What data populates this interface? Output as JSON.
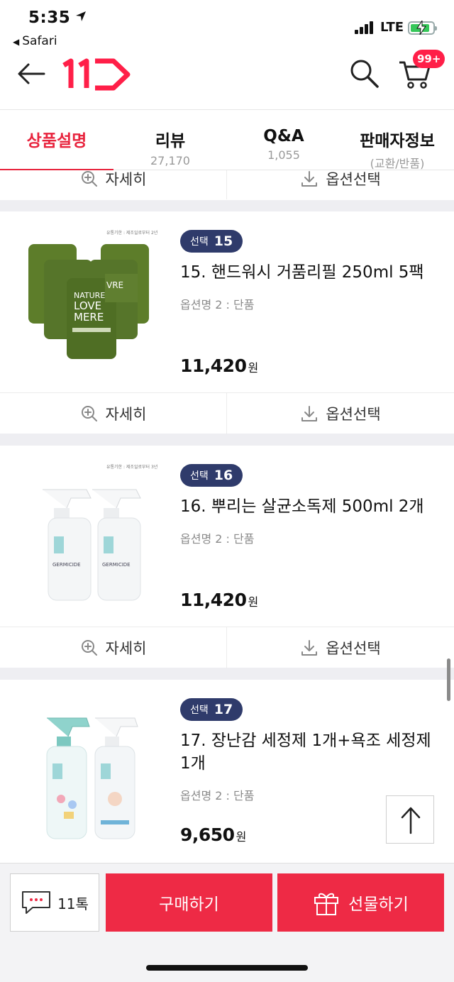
{
  "status": {
    "time": "5:35",
    "back_app": "Safari",
    "network": "LTE"
  },
  "header": {
    "cart_badge": "99+"
  },
  "tabs": [
    {
      "label": "상품설명",
      "sub": ""
    },
    {
      "label": "리뷰",
      "sub": "27,170"
    },
    {
      "label": "Q&A",
      "sub": "1,055"
    },
    {
      "label": "판매자정보",
      "sub": "(교환/반품)"
    }
  ],
  "actions": {
    "detail": "자세히",
    "option": "옵션선택"
  },
  "products": [
    {
      "badge_word": "선택",
      "badge_num": "15",
      "title": "15. 핸드워시 거품리필 250ml 5팩",
      "option": "옵션명 2 : 단품",
      "price": "11,420",
      "unit": "원"
    },
    {
      "badge_word": "선택",
      "badge_num": "16",
      "title": "16. 뿌리는 살균소독제 500ml 2개",
      "option": "옵션명 2 : 단품",
      "price": "11,420",
      "unit": "원"
    },
    {
      "badge_word": "선택",
      "badge_num": "17",
      "title": "17. 장난감 세정제 1개+욕조 세정제 1개",
      "option": "옵션명 2 : 단품",
      "price": "9,650",
      "unit": "원"
    }
  ],
  "thumb_text": {
    "brand_line1": "NATURE",
    "brand_line2": "LOVE",
    "brand_line3": "MERE",
    "bottle_label": "GERMICIDE",
    "shelf_life_1": "유통기한 : 제조일로부터 2년",
    "shelf_life_2": "유통기한 : 제조일로부터 3년"
  },
  "bottom": {
    "talk": "11톡",
    "buy": "구매하기",
    "gift": "선물하기"
  },
  "colors": {
    "accent": "#e8233d",
    "badge": "#2f3b6b",
    "button": "#ee2a45"
  }
}
